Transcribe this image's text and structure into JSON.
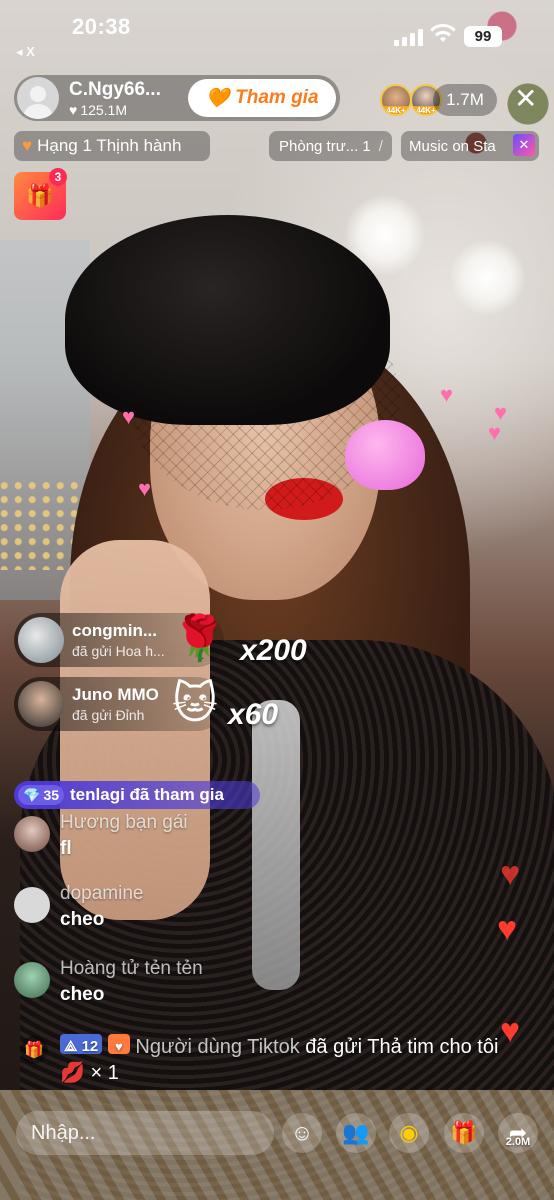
{
  "status_bar": {
    "time": "20:38",
    "back_label": "◂ X",
    "battery": "99"
  },
  "host": {
    "name": "C.Ngy66...",
    "likes": "125.1M",
    "join_label": "Tham gia"
  },
  "viewers": {
    "badge1": "44K+",
    "badge2": "44K+",
    "count": "1.7M"
  },
  "chips": {
    "ranking": "Hạng 1 Thịnh hành",
    "room": "Phòng trư... 1",
    "music": "Music on Sta"
  },
  "gift_box_count": "3",
  "gifts": [
    {
      "name": "congmin...",
      "detail": "đã gửi Hoa h...",
      "multiplier": "x200",
      "icon": "rose-icon"
    },
    {
      "name": "Juno MMO",
      "detail": "đã gửi Đỉnh",
      "multiplier": "x60",
      "icon": "cat-icon"
    }
  ],
  "join_banner": {
    "level": "35",
    "text": "tenlagi đã tham gia"
  },
  "chat": [
    {
      "name": "Hương bạn gái",
      "message": "fl"
    },
    {
      "name": "dopamine",
      "message": "cheo"
    },
    {
      "name": "Hoàng tử tẻn tẻn",
      "message": "cheo"
    }
  ],
  "system_gift": {
    "level": "12",
    "sender": "Người dùng Tiktok",
    "text_after": "đã gửi Thả tim cho tôi",
    "count": "× 1"
  },
  "bottom_bar": {
    "input_placeholder": "Nhập...",
    "share_count": "2.0M"
  },
  "colors": {
    "join": "#ff7a1a",
    "banner": "#4d3bd6",
    "heart": "#ff3b30"
  }
}
